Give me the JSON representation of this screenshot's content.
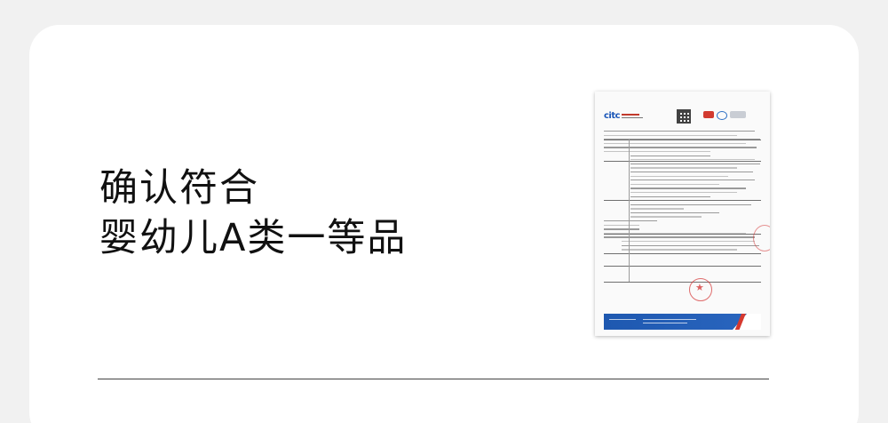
{
  "headline": {
    "line1": "确认符合",
    "line2": "婴幼儿A类一等品"
  },
  "colors": {
    "background": "#f1f1f1",
    "card": "#ffffff",
    "text": "#111111",
    "brand_blue": "#1e58b0",
    "brand_red": "#d6392f"
  },
  "report": {
    "logo_text": "citc"
  }
}
